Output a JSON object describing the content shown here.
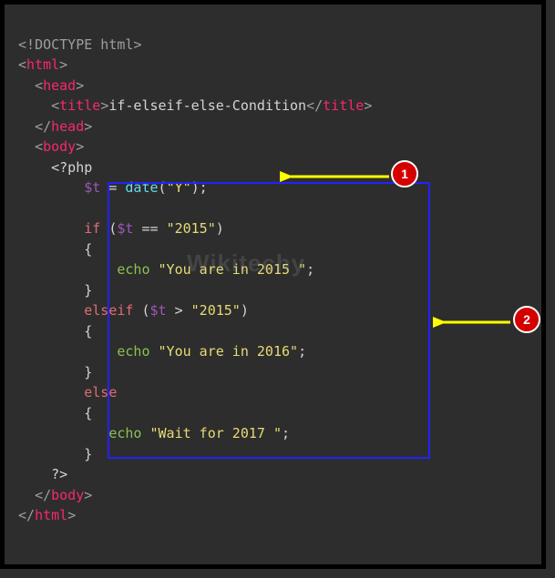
{
  "code": {
    "doctype_open": "<!",
    "doctype_text": "DOCTYPE html",
    "doctype_close": ">",
    "html_open_l": "<",
    "html_tag": "html",
    "gt": ">",
    "lt_slash": "</",
    "head_tag": "head",
    "title_tag": "title",
    "title_text": "if-elseif-else-Condition",
    "body_tag": "body",
    "php_open": "<?php",
    "var_t": "$t",
    "eq": " = ",
    "date_fn": "date",
    "paren_open": "(",
    "str_y": "\"Y\"",
    "paren_close_semi": ");",
    "if_kw": "if",
    "cond1_open": " (",
    "cond1_eqeq": " == ",
    "str_2015": "\"2015\"",
    "paren_close": ")",
    "brace_open": "{",
    "echo_kw": "echo",
    "str_in2015": "\"You are in 2015 \"",
    "semi": ";",
    "brace_close": "}",
    "elseif_kw": "elseif",
    "cond2_gt": " > ",
    "str_in2016": "\"You are in 2016\"",
    "else_kw": "else",
    "str_wait2017": "\"Wait for 2017 \"",
    "php_close": "?>"
  },
  "annotations": {
    "badge1": "1",
    "badge2": "2"
  },
  "watermark": "Wikitechy"
}
